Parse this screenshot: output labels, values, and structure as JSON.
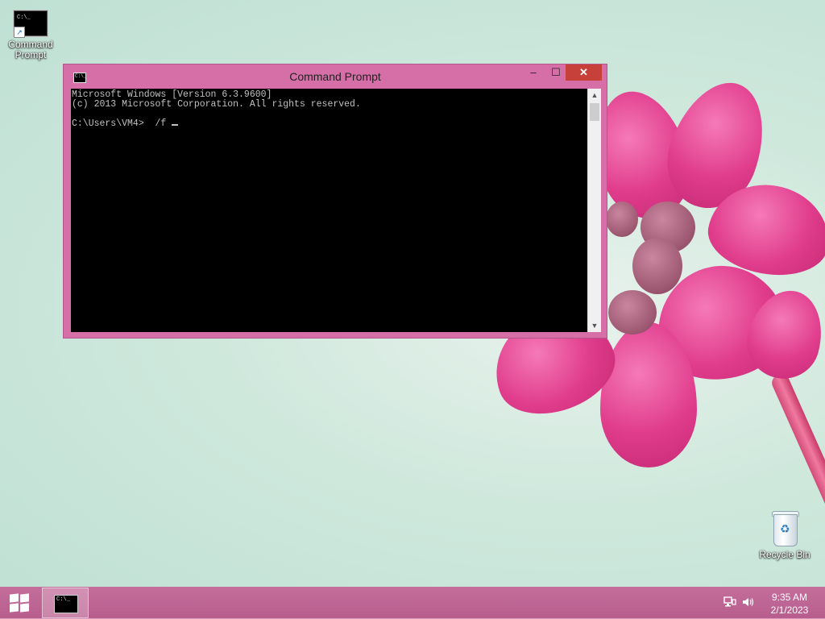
{
  "desktop": {
    "icons": [
      {
        "label": "Command Prompt",
        "icon": "cmd-icon"
      },
      {
        "label": "Recycle Bin",
        "icon": "recycle-bin-icon"
      }
    ]
  },
  "window": {
    "title": "Command Prompt",
    "buttons": {
      "minimize": "–",
      "maximize": "☐",
      "close": "✕"
    },
    "console_lines": [
      "Microsoft Windows [Version 6.3.9600]",
      "(c) 2013 Microsoft Corporation. All rights reserved.",
      "",
      "C:\\Users\\VM4>  /f "
    ],
    "icon_text": "C:\\_"
  },
  "taskbar": {
    "start_icon": "windows-logo-icon",
    "pinned": [
      {
        "name": "Command Prompt",
        "icon_text": "C:\\_"
      }
    ],
    "tray": {
      "network_icon": "network-icon",
      "volume_icon": "volume-icon"
    },
    "clock": {
      "time": "9:35 AM",
      "date": "2/1/2023"
    }
  },
  "colors": {
    "window_frame": "#d66fa7",
    "close_button": "#c7403a",
    "taskbar": "#bd6593"
  }
}
